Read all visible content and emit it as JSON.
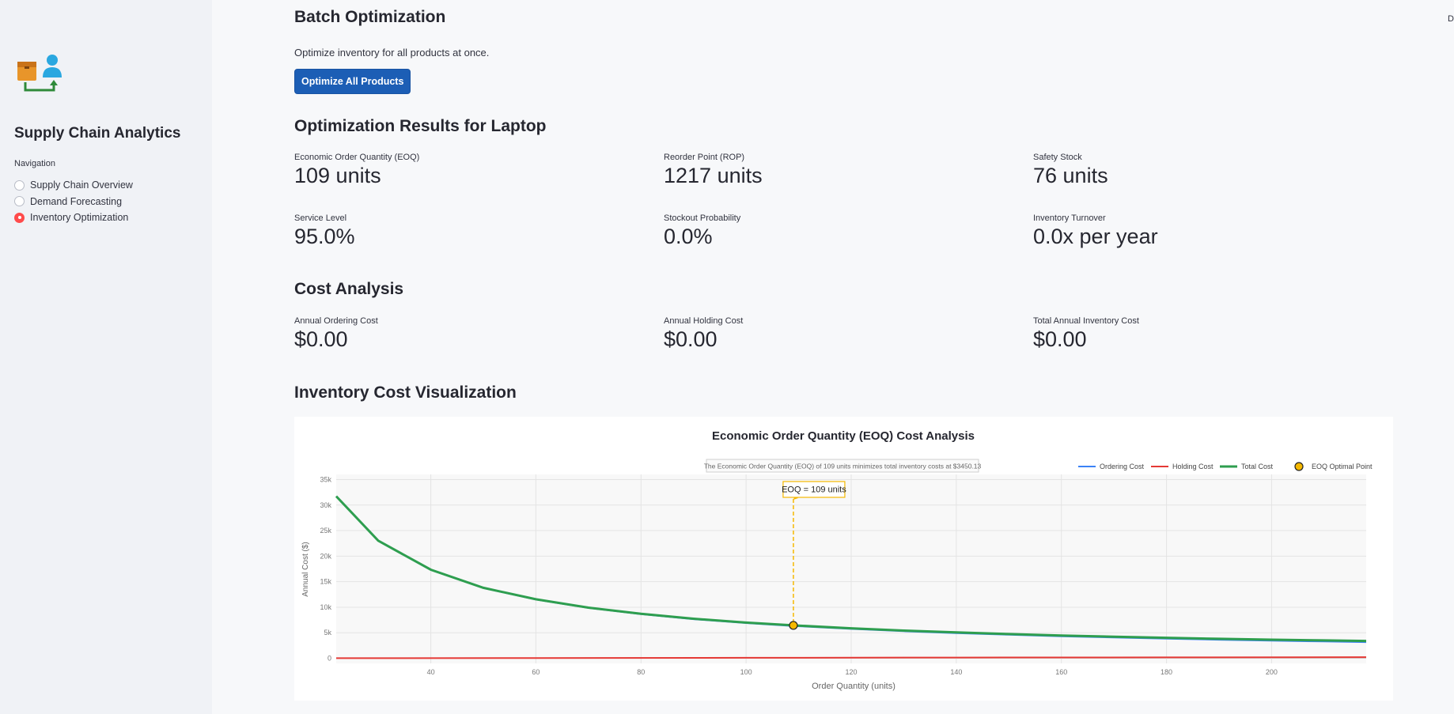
{
  "sidebar": {
    "title": "Supply Chain Analytics",
    "nav_label": "Navigation",
    "items": [
      {
        "label": "Supply Chain Overview",
        "selected": false
      },
      {
        "label": "Demand Forecasting",
        "selected": false
      },
      {
        "label": "Inventory Optimization",
        "selected": true
      }
    ]
  },
  "header_corner_text": "D",
  "batch": {
    "title": "Batch Optimization",
    "description": "Optimize inventory for all products at once.",
    "button_label": "Optimize All Products"
  },
  "results": {
    "title": "Optimization Results for Laptop",
    "metrics": [
      {
        "label": "Economic Order Quantity (EOQ)",
        "value": "109 units"
      },
      {
        "label": "Reorder Point (ROP)",
        "value": "1217 units"
      },
      {
        "label": "Safety Stock",
        "value": "76 units"
      },
      {
        "label": "Service Level",
        "value": "95.0%"
      },
      {
        "label": "Stockout Probability",
        "value": "0.0%"
      },
      {
        "label": "Inventory Turnover",
        "value": "0.0x per year"
      }
    ]
  },
  "cost": {
    "title": "Cost Analysis",
    "metrics": [
      {
        "label": "Annual Ordering Cost",
        "value": "$0.00"
      },
      {
        "label": "Annual Holding Cost",
        "value": "$0.00"
      },
      {
        "label": "Total Annual Inventory Cost",
        "value": "$0.00"
      }
    ]
  },
  "viz": {
    "title": "Inventory Cost Visualization"
  },
  "colors": {
    "accent": "#1c5eb5",
    "radio_selected": "#ff4b4b",
    "ordering": "#3b82f6",
    "holding": "#e53935",
    "total": "#2e9e4f",
    "eoq": "#f5b800"
  },
  "chart_data": {
    "type": "line",
    "title": "Economic Order Quantity (EOQ) Cost Analysis",
    "subtitle": "The Economic Order Quantity (EOQ) of 109 units minimizes total inventory costs at $3450.13",
    "xlabel": "Order Quantity (units)",
    "ylabel": "Annual Cost ($)",
    "xlim": [
      22,
      218
    ],
    "ylim": [
      -1000,
      36000
    ],
    "xticks": [
      40,
      60,
      80,
      100,
      120,
      140,
      160,
      180,
      200
    ],
    "yticks": [
      0,
      5000,
      10000,
      15000,
      20000,
      25000,
      30000,
      35000
    ],
    "ytick_labels": [
      "0",
      "5k",
      "10k",
      "15k",
      "20k",
      "25k",
      "30k",
      "35k"
    ],
    "legend_position": "top-right",
    "grid": true,
    "series": [
      {
        "name": "Ordering Cost",
        "color": "#3b82f6",
        "x": [
          22,
          30,
          40,
          50,
          60,
          70,
          80,
          90,
          100,
          109,
          120,
          130,
          140,
          150,
          160,
          170,
          180,
          190,
          200,
          210,
          218
        ],
        "y": [
          31700,
          23000,
          17300,
          13750,
          11500,
          9850,
          8630,
          7650,
          6890,
          6330,
          5750,
          5300,
          4930,
          4600,
          4310,
          4060,
          3830,
          3630,
          3450,
          3290,
          3170
        ]
      },
      {
        "name": "Holding Cost",
        "color": "#e53935",
        "x": [
          22,
          60,
          100,
          140,
          180,
          218
        ],
        "y": [
          20,
          60,
          100,
          140,
          180,
          220
        ]
      },
      {
        "name": "Total Cost",
        "color": "#2e9e4f",
        "x": [
          22,
          30,
          40,
          50,
          60,
          70,
          80,
          90,
          100,
          109,
          120,
          130,
          140,
          150,
          160,
          170,
          180,
          190,
          200,
          210,
          218
        ],
        "y": [
          31720,
          23030,
          17340,
          13800,
          11560,
          9920,
          8710,
          7740,
          6990,
          6440,
          5870,
          5430,
          5070,
          4750,
          4470,
          4230,
          4010,
          3820,
          3650,
          3500,
          3390
        ]
      }
    ],
    "eoq_point": {
      "name": "EOQ Optimal Point",
      "x": 109,
      "y": 6440,
      "label": "EOQ = 109 units"
    }
  }
}
